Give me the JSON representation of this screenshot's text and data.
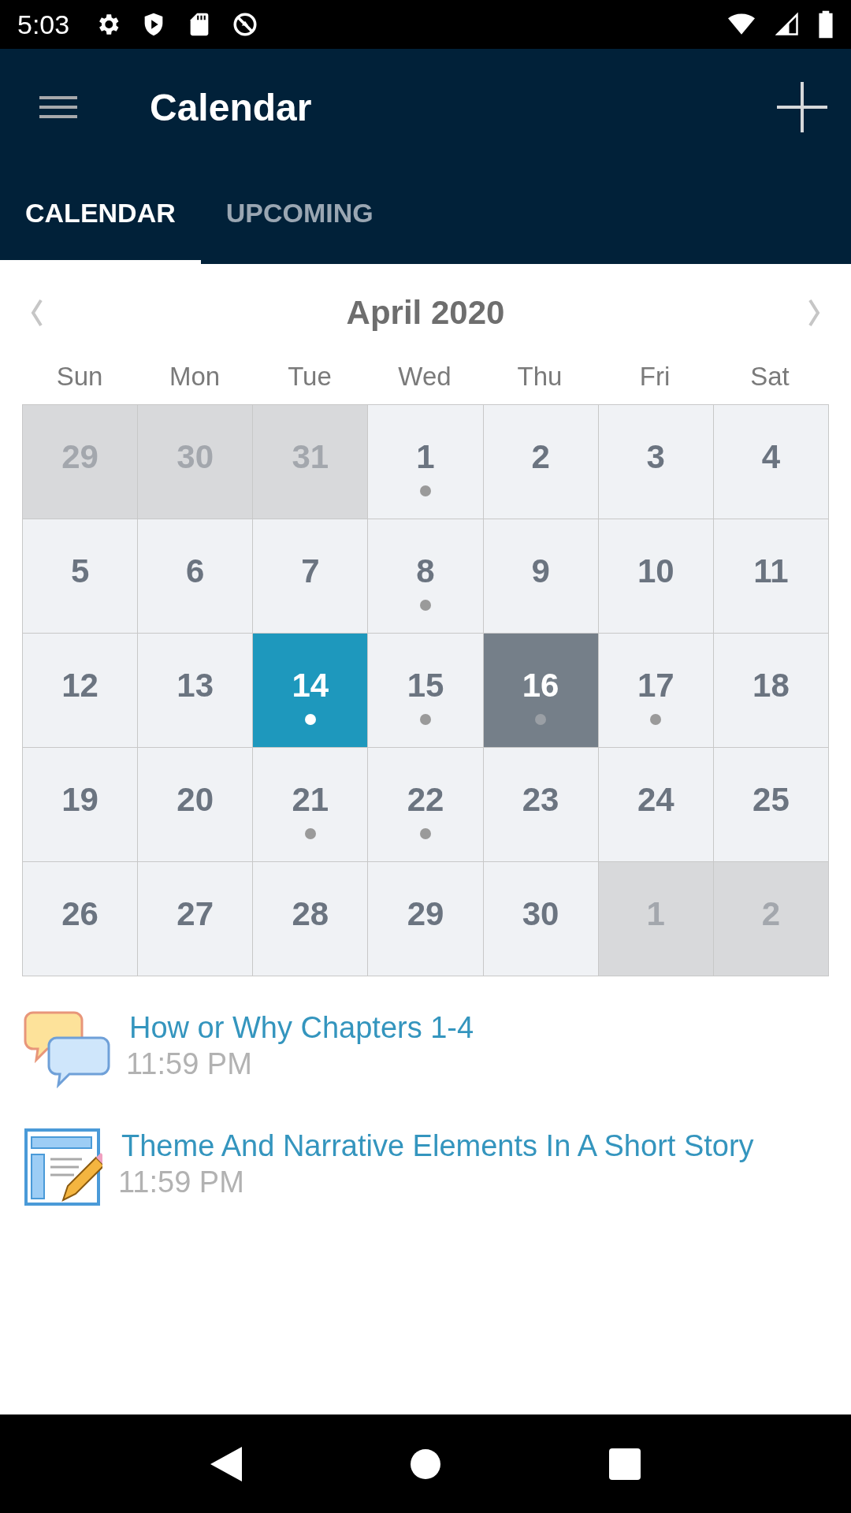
{
  "status_bar": {
    "time": "5:03"
  },
  "app_bar": {
    "title": "Calendar"
  },
  "tabs": [
    {
      "label": "CALENDAR",
      "selected": true
    },
    {
      "label": "UPCOMING",
      "selected": false
    }
  ],
  "month": {
    "title": "April 2020"
  },
  "weekdays": [
    "Sun",
    "Mon",
    "Tue",
    "Wed",
    "Thu",
    "Fri",
    "Sat"
  ],
  "days": [
    {
      "label": "29",
      "in_month": false,
      "selected": false,
      "today": false,
      "has_events": false
    },
    {
      "label": "30",
      "in_month": false,
      "selected": false,
      "today": false,
      "has_events": false
    },
    {
      "label": "31",
      "in_month": false,
      "selected": false,
      "today": false,
      "has_events": false
    },
    {
      "label": "1",
      "in_month": true,
      "selected": false,
      "today": false,
      "has_events": true
    },
    {
      "label": "2",
      "in_month": true,
      "selected": false,
      "today": false,
      "has_events": false
    },
    {
      "label": "3",
      "in_month": true,
      "selected": false,
      "today": false,
      "has_events": false
    },
    {
      "label": "4",
      "in_month": true,
      "selected": false,
      "today": false,
      "has_events": false
    },
    {
      "label": "5",
      "in_month": true,
      "selected": false,
      "today": false,
      "has_events": false
    },
    {
      "label": "6",
      "in_month": true,
      "selected": false,
      "today": false,
      "has_events": false
    },
    {
      "label": "7",
      "in_month": true,
      "selected": false,
      "today": false,
      "has_events": false
    },
    {
      "label": "8",
      "in_month": true,
      "selected": false,
      "today": false,
      "has_events": true
    },
    {
      "label": "9",
      "in_month": true,
      "selected": false,
      "today": false,
      "has_events": false
    },
    {
      "label": "10",
      "in_month": true,
      "selected": false,
      "today": false,
      "has_events": false
    },
    {
      "label": "11",
      "in_month": true,
      "selected": false,
      "today": false,
      "has_events": false
    },
    {
      "label": "12",
      "in_month": true,
      "selected": false,
      "today": false,
      "has_events": false
    },
    {
      "label": "13",
      "in_month": true,
      "selected": false,
      "today": false,
      "has_events": false
    },
    {
      "label": "14",
      "in_month": true,
      "selected": true,
      "today": false,
      "has_events": true
    },
    {
      "label": "15",
      "in_month": true,
      "selected": false,
      "today": false,
      "has_events": true
    },
    {
      "label": "16",
      "in_month": true,
      "selected": false,
      "today": true,
      "has_events": true
    },
    {
      "label": "17",
      "in_month": true,
      "selected": false,
      "today": false,
      "has_events": true
    },
    {
      "label": "18",
      "in_month": true,
      "selected": false,
      "today": false,
      "has_events": false
    },
    {
      "label": "19",
      "in_month": true,
      "selected": false,
      "today": false,
      "has_events": false
    },
    {
      "label": "20",
      "in_month": true,
      "selected": false,
      "today": false,
      "has_events": false
    },
    {
      "label": "21",
      "in_month": true,
      "selected": false,
      "today": false,
      "has_events": true
    },
    {
      "label": "22",
      "in_month": true,
      "selected": false,
      "today": false,
      "has_events": true
    },
    {
      "label": "23",
      "in_month": true,
      "selected": false,
      "today": false,
      "has_events": false
    },
    {
      "label": "24",
      "in_month": true,
      "selected": false,
      "today": false,
      "has_events": false
    },
    {
      "label": "25",
      "in_month": true,
      "selected": false,
      "today": false,
      "has_events": false
    },
    {
      "label": "26",
      "in_month": true,
      "selected": false,
      "today": false,
      "has_events": false
    },
    {
      "label": "27",
      "in_month": true,
      "selected": false,
      "today": false,
      "has_events": false
    },
    {
      "label": "28",
      "in_month": true,
      "selected": false,
      "today": false,
      "has_events": false
    },
    {
      "label": "29",
      "in_month": true,
      "selected": false,
      "today": false,
      "has_events": false
    },
    {
      "label": "30",
      "in_month": true,
      "selected": false,
      "today": false,
      "has_events": false
    },
    {
      "label": "1",
      "in_month": false,
      "selected": false,
      "today": false,
      "has_events": false
    },
    {
      "label": "2",
      "in_month": false,
      "selected": false,
      "today": false,
      "has_events": false
    }
  ],
  "events": [
    {
      "kind": "forum",
      "title": "How or Why Chapters 1-4",
      "time": "11:59 PM"
    },
    {
      "kind": "assignment",
      "title": "Theme And Narrative Elements In A Short Story",
      "time": "11:59 PM"
    }
  ]
}
